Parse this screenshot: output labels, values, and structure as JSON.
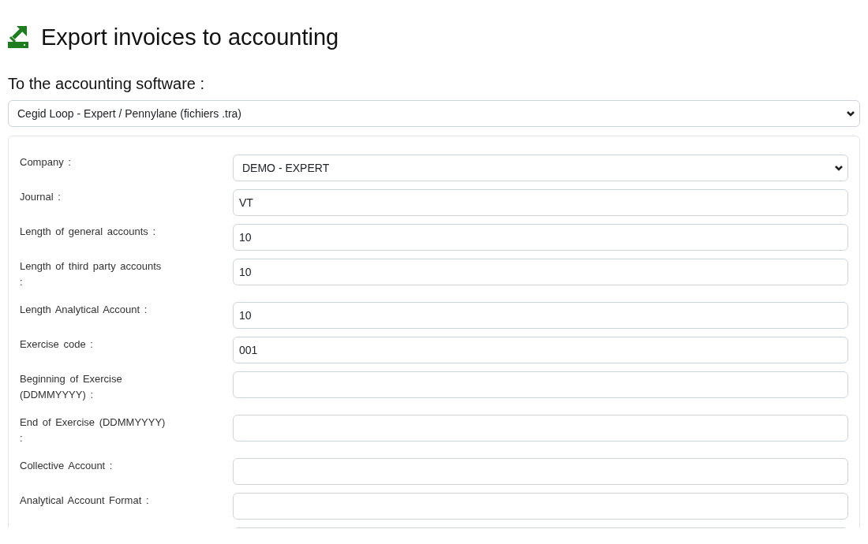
{
  "page": {
    "title": "Export invoices to accounting"
  },
  "software": {
    "label": "To the accounting software :",
    "value": "Cegid Loop - Expert / Pennylane (fichiers .tra)"
  },
  "settings": {
    "fields": [
      {
        "kind": "dropdown",
        "label": "Company :",
        "value": "DEMO - EXPERT"
      },
      {
        "kind": "text",
        "label": "Journal :",
        "value": "VT"
      },
      {
        "kind": "text",
        "label": "Length of general accounts :",
        "value": "10"
      },
      {
        "kind": "text",
        "label": "Length of third party accounts :",
        "value": "10"
      },
      {
        "kind": "text",
        "label": "Length Analytical Account :",
        "value": "10"
      },
      {
        "kind": "text",
        "label": "Exercise code :",
        "value": "001"
      },
      {
        "kind": "text",
        "label": "Beginning of Exercise (DDMMYYYY) :"
      },
      {
        "kind": "text",
        "label": "End of Exercise (DDMMYYYY) :"
      },
      {
        "kind": "text",
        "label": "Collective Account :"
      },
      {
        "kind": "text",
        "label": "Analytical Account Format :"
      },
      {
        "kind": "text"
      }
    ]
  }
}
